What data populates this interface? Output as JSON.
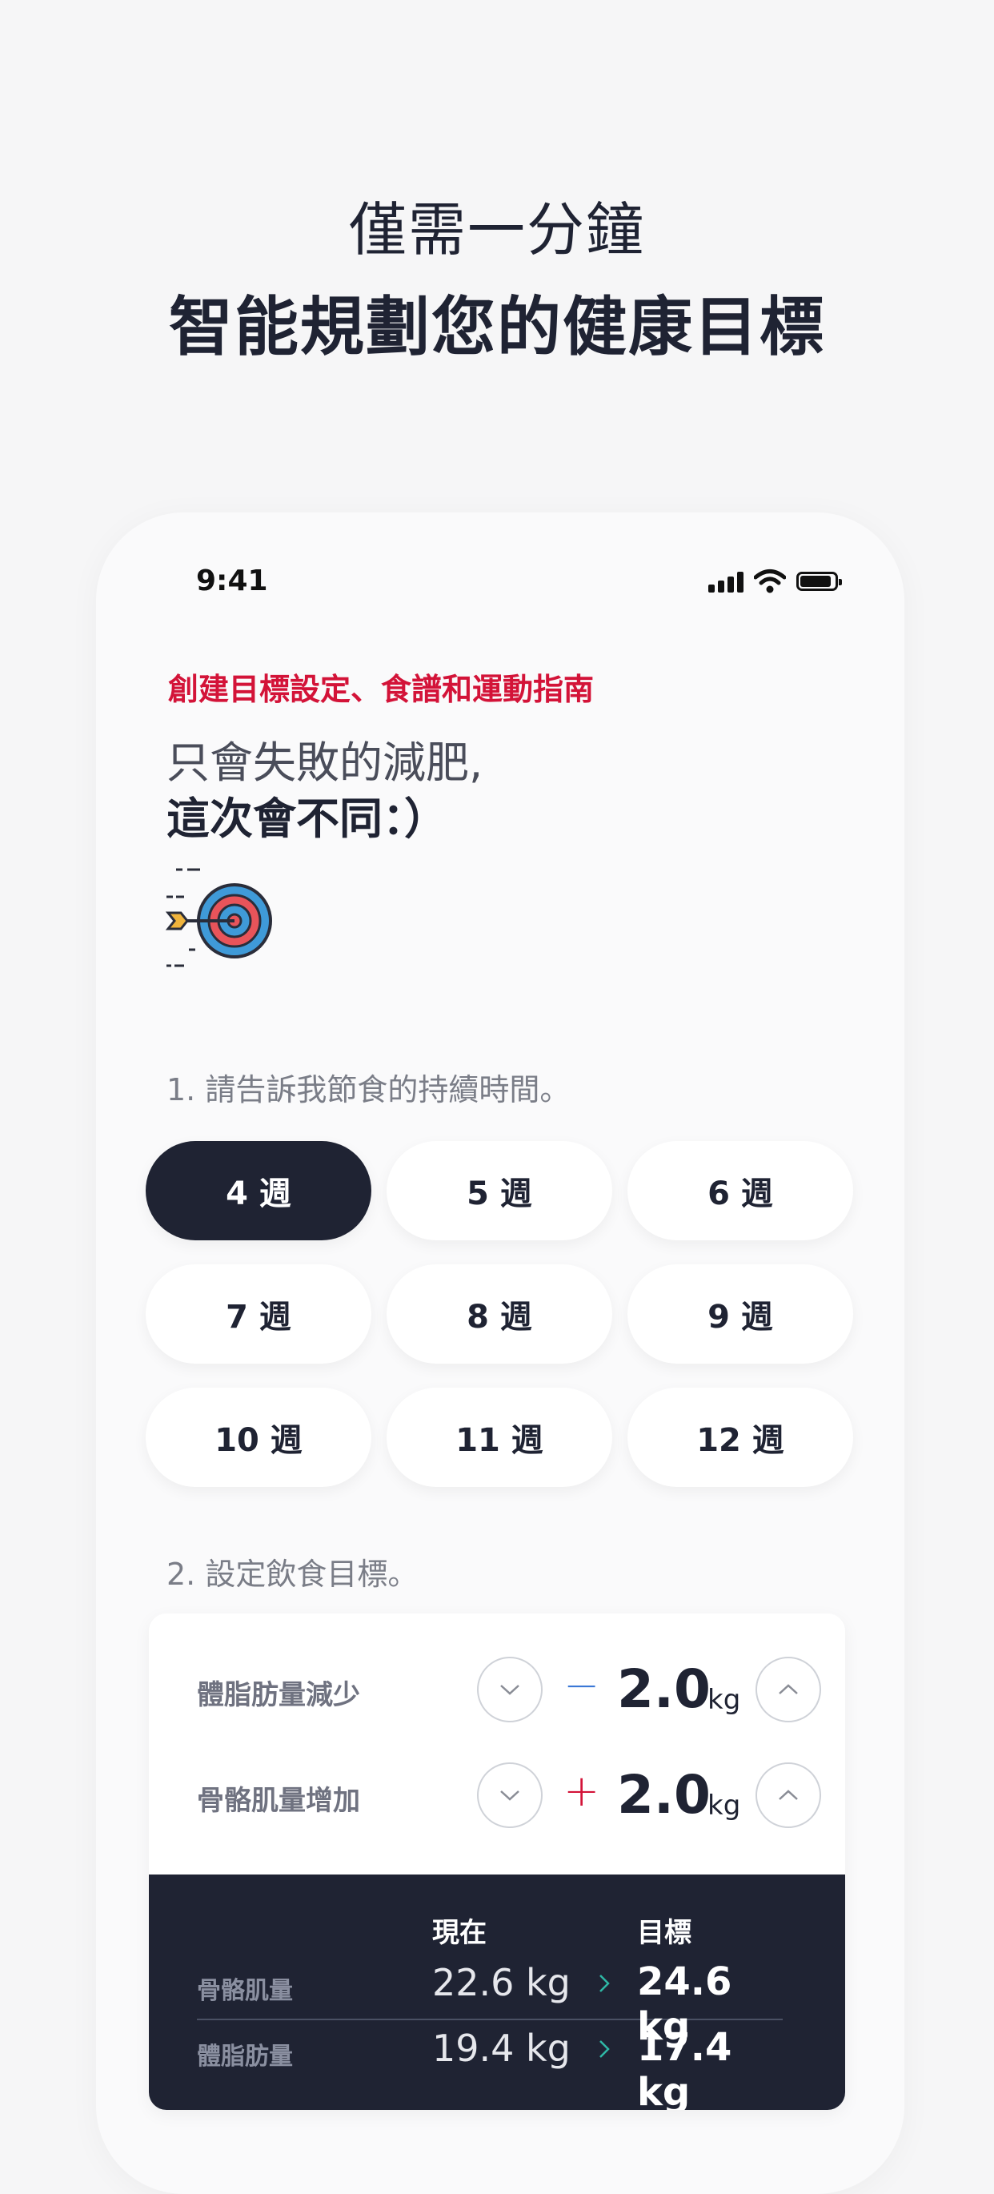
{
  "header": {
    "line1": "僅需一分鐘",
    "line2": "智能規劃您的健康目標"
  },
  "status_bar": {
    "time": "9:41"
  },
  "intro": {
    "subhead": "創建目標設定、食譜和運動指南",
    "lead_line1": "只會失敗的減肥,",
    "lead_line2": "這次會不同：）"
  },
  "duration": {
    "question": "1. 請告訴我節食的持續時間。",
    "options": [
      "4 週",
      "5 週",
      "6 週",
      "7 週",
      "8 週",
      "9 週",
      "10 週",
      "11 週",
      "12 週"
    ],
    "selected": "4 週"
  },
  "goal": {
    "question": "2. 設定飲食目標。",
    "rows": [
      {
        "label": "體脂肪量減少",
        "sign": "−",
        "value": "2.0",
        "unit": "kg"
      },
      {
        "label": "骨骼肌量增加",
        "sign": "+",
        "value": "2.0",
        "unit": "kg"
      }
    ]
  },
  "summary": {
    "col_now": "現在",
    "col_goal": "目標",
    "rows": [
      {
        "label": "骨骼肌量",
        "now": "22.6 kg",
        "goal": "24.6 kg"
      },
      {
        "label": "體脂肪量",
        "now": "19.4 kg",
        "goal": "17.4 kg"
      }
    ]
  },
  "colors": {
    "accent_red": "#d31338",
    "navy": "#1f2333",
    "minus_blue": "#3b78d6",
    "arrow_teal": "#2fb8a6"
  }
}
